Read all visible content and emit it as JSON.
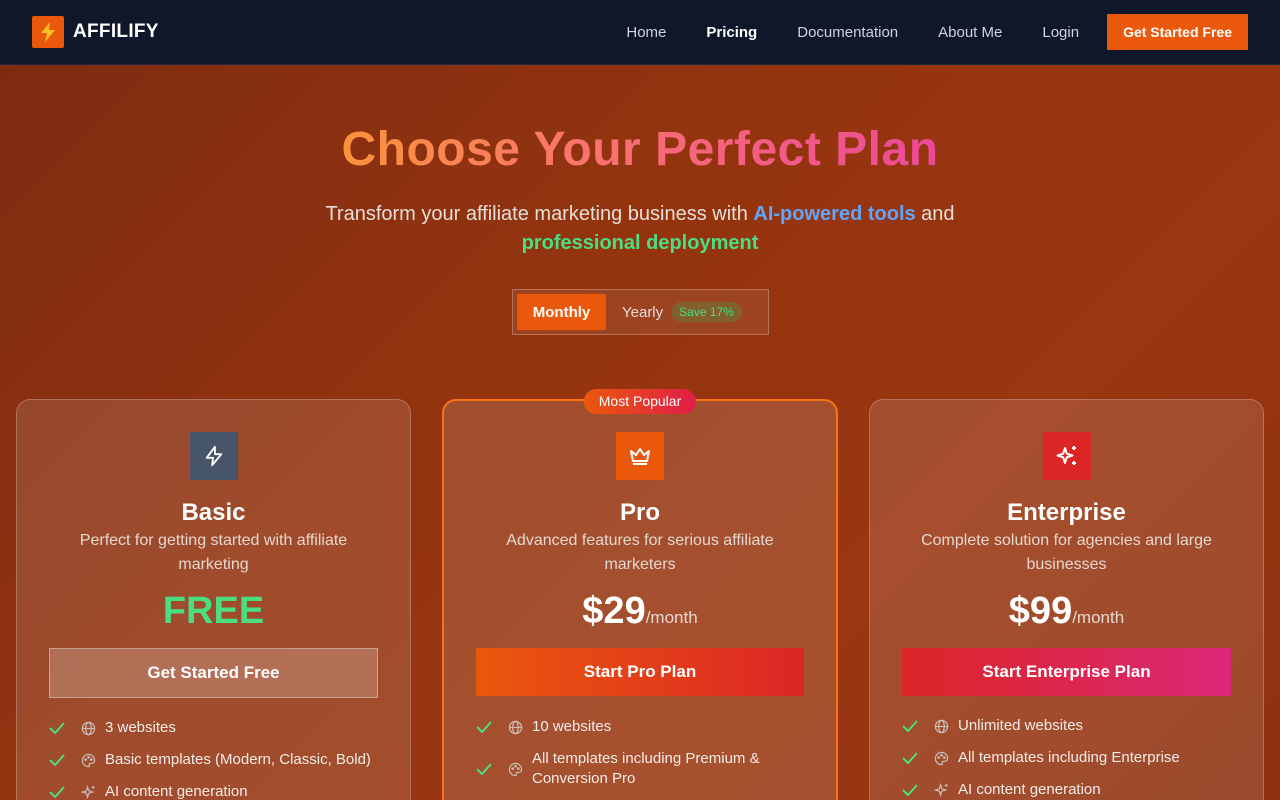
{
  "brand": {
    "name": "AFFILIFY",
    "logo_icon": "lightning-icon"
  },
  "nav": {
    "links": [
      "Home",
      "Pricing",
      "Documentation",
      "About Me",
      "Login"
    ],
    "active": "Pricing",
    "cta": "Get Started Free"
  },
  "hero": {
    "title": "Choose Your Perfect Plan",
    "subtitle_pre": "Transform your affiliate marketing business with ",
    "subtitle_hl1": "AI-powered tools",
    "subtitle_mid": " and ",
    "subtitle_hl2": "professional deployment"
  },
  "billing": {
    "monthly": "Monthly",
    "yearly": "Yearly",
    "save_badge": "Save 17%",
    "selected": "Monthly"
  },
  "plans": [
    {
      "name": "Basic",
      "icon": "lightning-icon",
      "description": "Perfect for getting started with affiliate marketing",
      "price": "FREE",
      "period": "",
      "button": "Get Started Free",
      "features": [
        {
          "icon": "globe-icon",
          "text": "3 websites"
        },
        {
          "icon": "palette-icon",
          "text": "Basic templates (Modern, Classic, Bold)"
        },
        {
          "icon": "sparkles-icon",
          "text": "AI content generation"
        }
      ]
    },
    {
      "name": "Pro",
      "icon": "crown-icon",
      "badge": "Most Popular",
      "description": "Advanced features for serious affiliate marketers",
      "price": "$29",
      "period": "/month",
      "button": "Start Pro Plan",
      "features": [
        {
          "icon": "globe-icon",
          "text": "10 websites"
        },
        {
          "icon": "palette-icon",
          "text": "All templates including Premium & Conversion Pro"
        }
      ]
    },
    {
      "name": "Enterprise",
      "icon": "sparkles-icon",
      "description": "Complete solution for agencies and large businesses",
      "price": "$99",
      "period": "/month",
      "button": "Start Enterprise Plan",
      "features": [
        {
          "icon": "globe-icon",
          "text": "Unlimited websites"
        },
        {
          "icon": "palette-icon",
          "text": "All templates including Enterprise"
        },
        {
          "icon": "sparkles-icon",
          "text": "AI content generation"
        }
      ]
    }
  ],
  "colors": {
    "accent": "#ea580c",
    "nav_bg": "#0f172a",
    "check": "#4ade80"
  }
}
